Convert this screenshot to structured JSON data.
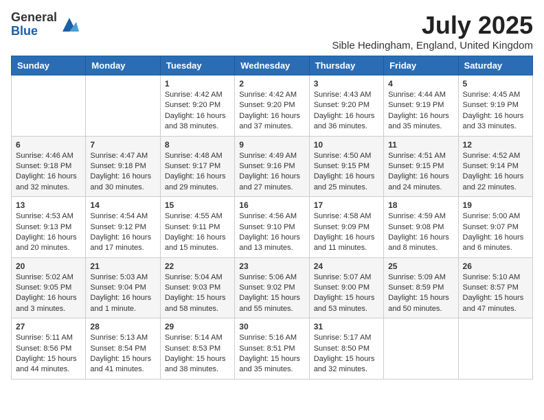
{
  "logo": {
    "general": "General",
    "blue": "Blue"
  },
  "title": "July 2025",
  "subtitle": "Sible Hedingham, England, United Kingdom",
  "days_of_week": [
    "Sunday",
    "Monday",
    "Tuesday",
    "Wednesday",
    "Thursday",
    "Friday",
    "Saturday"
  ],
  "weeks": [
    [
      {
        "day": "",
        "sunrise": "",
        "sunset": "",
        "daylight": ""
      },
      {
        "day": "",
        "sunrise": "",
        "sunset": "",
        "daylight": ""
      },
      {
        "day": "1",
        "sunrise": "Sunrise: 4:42 AM",
        "sunset": "Sunset: 9:20 PM",
        "daylight": "Daylight: 16 hours and 38 minutes."
      },
      {
        "day": "2",
        "sunrise": "Sunrise: 4:42 AM",
        "sunset": "Sunset: 9:20 PM",
        "daylight": "Daylight: 16 hours and 37 minutes."
      },
      {
        "day": "3",
        "sunrise": "Sunrise: 4:43 AM",
        "sunset": "Sunset: 9:20 PM",
        "daylight": "Daylight: 16 hours and 36 minutes."
      },
      {
        "day": "4",
        "sunrise": "Sunrise: 4:44 AM",
        "sunset": "Sunset: 9:19 PM",
        "daylight": "Daylight: 16 hours and 35 minutes."
      },
      {
        "day": "5",
        "sunrise": "Sunrise: 4:45 AM",
        "sunset": "Sunset: 9:19 PM",
        "daylight": "Daylight: 16 hours and 33 minutes."
      }
    ],
    [
      {
        "day": "6",
        "sunrise": "Sunrise: 4:46 AM",
        "sunset": "Sunset: 9:18 PM",
        "daylight": "Daylight: 16 hours and 32 minutes."
      },
      {
        "day": "7",
        "sunrise": "Sunrise: 4:47 AM",
        "sunset": "Sunset: 9:18 PM",
        "daylight": "Daylight: 16 hours and 30 minutes."
      },
      {
        "day": "8",
        "sunrise": "Sunrise: 4:48 AM",
        "sunset": "Sunset: 9:17 PM",
        "daylight": "Daylight: 16 hours and 29 minutes."
      },
      {
        "day": "9",
        "sunrise": "Sunrise: 4:49 AM",
        "sunset": "Sunset: 9:16 PM",
        "daylight": "Daylight: 16 hours and 27 minutes."
      },
      {
        "day": "10",
        "sunrise": "Sunrise: 4:50 AM",
        "sunset": "Sunset: 9:15 PM",
        "daylight": "Daylight: 16 hours and 25 minutes."
      },
      {
        "day": "11",
        "sunrise": "Sunrise: 4:51 AM",
        "sunset": "Sunset: 9:15 PM",
        "daylight": "Daylight: 16 hours and 24 minutes."
      },
      {
        "day": "12",
        "sunrise": "Sunrise: 4:52 AM",
        "sunset": "Sunset: 9:14 PM",
        "daylight": "Daylight: 16 hours and 22 minutes."
      }
    ],
    [
      {
        "day": "13",
        "sunrise": "Sunrise: 4:53 AM",
        "sunset": "Sunset: 9:13 PM",
        "daylight": "Daylight: 16 hours and 20 minutes."
      },
      {
        "day": "14",
        "sunrise": "Sunrise: 4:54 AM",
        "sunset": "Sunset: 9:12 PM",
        "daylight": "Daylight: 16 hours and 17 minutes."
      },
      {
        "day": "15",
        "sunrise": "Sunrise: 4:55 AM",
        "sunset": "Sunset: 9:11 PM",
        "daylight": "Daylight: 16 hours and 15 minutes."
      },
      {
        "day": "16",
        "sunrise": "Sunrise: 4:56 AM",
        "sunset": "Sunset: 9:10 PM",
        "daylight": "Daylight: 16 hours and 13 minutes."
      },
      {
        "day": "17",
        "sunrise": "Sunrise: 4:58 AM",
        "sunset": "Sunset: 9:09 PM",
        "daylight": "Daylight: 16 hours and 11 minutes."
      },
      {
        "day": "18",
        "sunrise": "Sunrise: 4:59 AM",
        "sunset": "Sunset: 9:08 PM",
        "daylight": "Daylight: 16 hours and 8 minutes."
      },
      {
        "day": "19",
        "sunrise": "Sunrise: 5:00 AM",
        "sunset": "Sunset: 9:07 PM",
        "daylight": "Daylight: 16 hours and 6 minutes."
      }
    ],
    [
      {
        "day": "20",
        "sunrise": "Sunrise: 5:02 AM",
        "sunset": "Sunset: 9:05 PM",
        "daylight": "Daylight: 16 hours and 3 minutes."
      },
      {
        "day": "21",
        "sunrise": "Sunrise: 5:03 AM",
        "sunset": "Sunset: 9:04 PM",
        "daylight": "Daylight: 16 hours and 1 minute."
      },
      {
        "day": "22",
        "sunrise": "Sunrise: 5:04 AM",
        "sunset": "Sunset: 9:03 PM",
        "daylight": "Daylight: 15 hours and 58 minutes."
      },
      {
        "day": "23",
        "sunrise": "Sunrise: 5:06 AM",
        "sunset": "Sunset: 9:02 PM",
        "daylight": "Daylight: 15 hours and 55 minutes."
      },
      {
        "day": "24",
        "sunrise": "Sunrise: 5:07 AM",
        "sunset": "Sunset: 9:00 PM",
        "daylight": "Daylight: 15 hours and 53 minutes."
      },
      {
        "day": "25",
        "sunrise": "Sunrise: 5:09 AM",
        "sunset": "Sunset: 8:59 PM",
        "daylight": "Daylight: 15 hours and 50 minutes."
      },
      {
        "day": "26",
        "sunrise": "Sunrise: 5:10 AM",
        "sunset": "Sunset: 8:57 PM",
        "daylight": "Daylight: 15 hours and 47 minutes."
      }
    ],
    [
      {
        "day": "27",
        "sunrise": "Sunrise: 5:11 AM",
        "sunset": "Sunset: 8:56 PM",
        "daylight": "Daylight: 15 hours and 44 minutes."
      },
      {
        "day": "28",
        "sunrise": "Sunrise: 5:13 AM",
        "sunset": "Sunset: 8:54 PM",
        "daylight": "Daylight: 15 hours and 41 minutes."
      },
      {
        "day": "29",
        "sunrise": "Sunrise: 5:14 AM",
        "sunset": "Sunset: 8:53 PM",
        "daylight": "Daylight: 15 hours and 38 minutes."
      },
      {
        "day": "30",
        "sunrise": "Sunrise: 5:16 AM",
        "sunset": "Sunset: 8:51 PM",
        "daylight": "Daylight: 15 hours and 35 minutes."
      },
      {
        "day": "31",
        "sunrise": "Sunrise: 5:17 AM",
        "sunset": "Sunset: 8:50 PM",
        "daylight": "Daylight: 15 hours and 32 minutes."
      },
      {
        "day": "",
        "sunrise": "",
        "sunset": "",
        "daylight": ""
      },
      {
        "day": "",
        "sunrise": "",
        "sunset": "",
        "daylight": ""
      }
    ]
  ]
}
